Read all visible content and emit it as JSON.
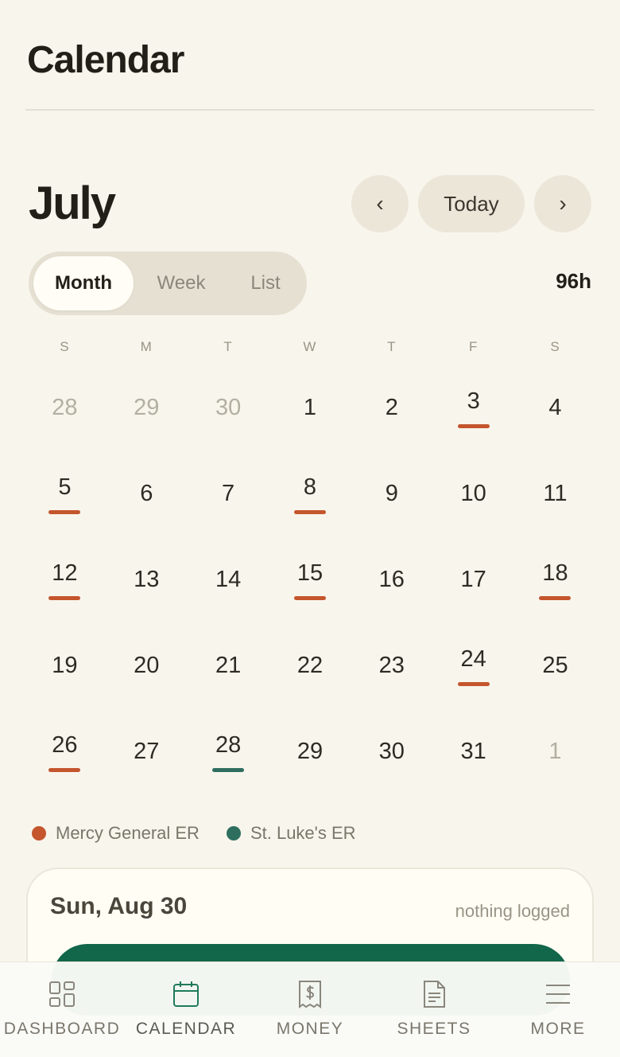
{
  "page": {
    "title": "Calendar"
  },
  "calendar": {
    "month": "July",
    "prev_label": "‹",
    "today_label": "Today",
    "next_label": "›",
    "views": [
      "Month",
      "Week",
      "List"
    ],
    "active_view": "Month",
    "total_hours": "96h",
    "weekdays": [
      "S",
      "M",
      "T",
      "W",
      "T",
      "F",
      "S"
    ],
    "weeks": [
      [
        {
          "n": "28",
          "out": true
        },
        {
          "n": "29",
          "out": true
        },
        {
          "n": "30",
          "out": true
        },
        {
          "n": "1"
        },
        {
          "n": "2"
        },
        {
          "n": "3",
          "shift": "mercy"
        },
        {
          "n": "4"
        }
      ],
      [
        {
          "n": "5",
          "shift": "mercy"
        },
        {
          "n": "6"
        },
        {
          "n": "7"
        },
        {
          "n": "8",
          "shift": "mercy"
        },
        {
          "n": "9"
        },
        {
          "n": "10"
        },
        {
          "n": "11"
        }
      ],
      [
        {
          "n": "12",
          "shift": "mercy"
        },
        {
          "n": "13"
        },
        {
          "n": "14"
        },
        {
          "n": "15",
          "shift": "mercy"
        },
        {
          "n": "16"
        },
        {
          "n": "17"
        },
        {
          "n": "18",
          "shift": "mercy"
        }
      ],
      [
        {
          "n": "19"
        },
        {
          "n": "20"
        },
        {
          "n": "21"
        },
        {
          "n": "22"
        },
        {
          "n": "23"
        },
        {
          "n": "24",
          "shift": "mercy"
        },
        {
          "n": "25"
        }
      ],
      [
        {
          "n": "26",
          "shift": "mercy"
        },
        {
          "n": "27"
        },
        {
          "n": "28",
          "shift": "stlukes"
        },
        {
          "n": "29"
        },
        {
          "n": "30"
        },
        {
          "n": "31"
        },
        {
          "n": "1",
          "out": true
        }
      ]
    ]
  },
  "legend": [
    {
      "key": "mercy",
      "label": "Mercy General ER",
      "color": "#c4552d"
    },
    {
      "key": "stlukes",
      "label": "St. Luke's ER",
      "color": "#2e6e5f"
    }
  ],
  "day_card": {
    "date": "Sun, Aug 30",
    "status": "nothing logged"
  },
  "bottom_nav": [
    {
      "key": "dashboard",
      "label": "DASHBOARD",
      "icon": "dashboard-icon",
      "active": false
    },
    {
      "key": "calendar",
      "label": "CALENDAR",
      "icon": "calendar-icon",
      "active": true
    },
    {
      "key": "money",
      "label": "MONEY",
      "icon": "money-icon",
      "active": false
    },
    {
      "key": "sheets",
      "label": "SHEETS",
      "icon": "sheets-icon",
      "active": false
    },
    {
      "key": "more",
      "label": "MORE",
      "icon": "menu-icon",
      "active": false
    }
  ],
  "colors": {
    "accent": "#12664a",
    "active_icon": "#1e7a5a",
    "muted_icon": "#8a867c"
  }
}
